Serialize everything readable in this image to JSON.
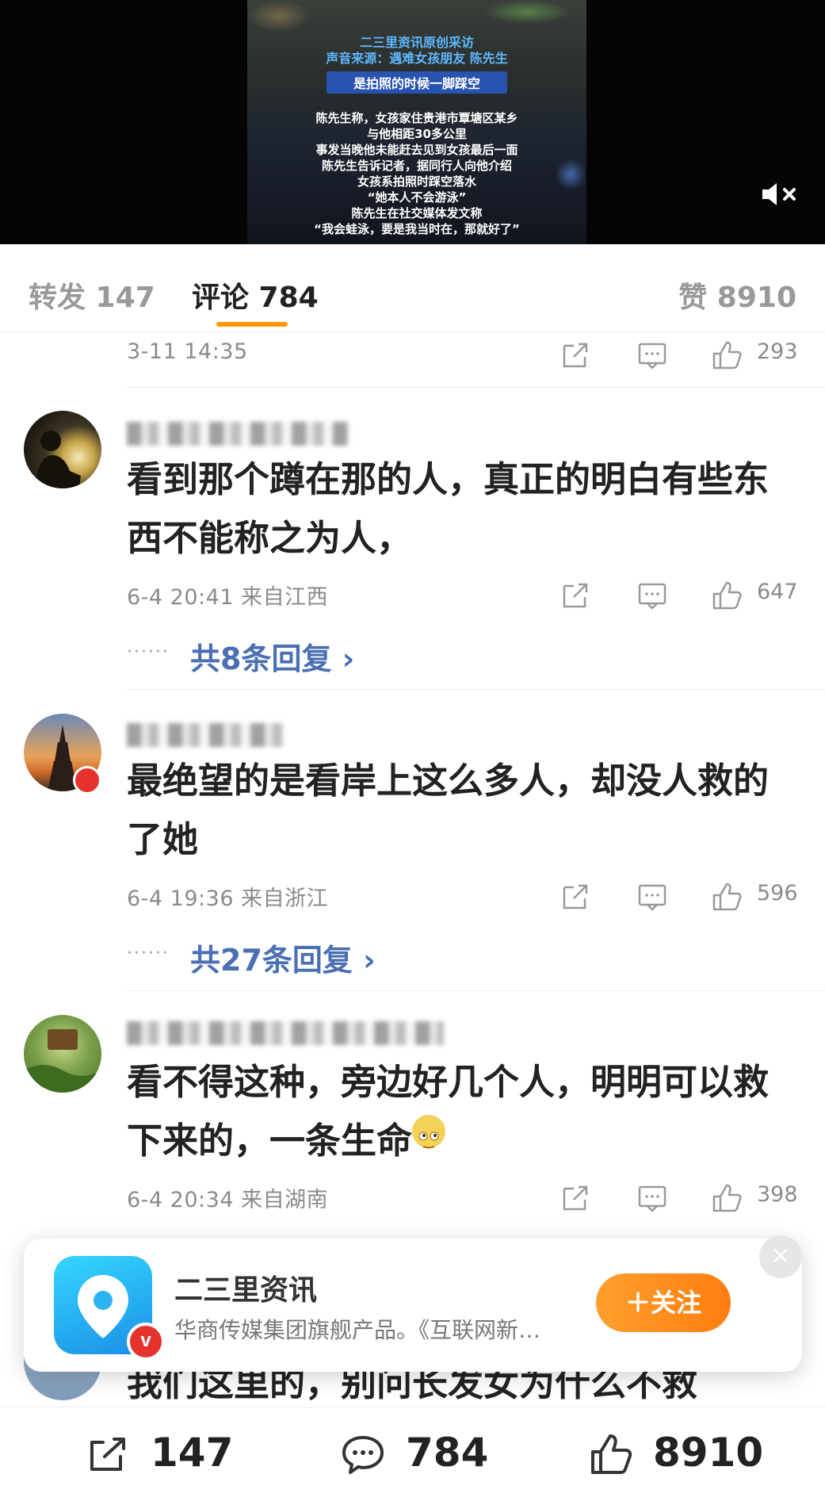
{
  "video": {
    "line1": "二三里资讯原创采访",
    "line2": "声音来源：遇难女孩朋友 陈先生",
    "highlight": "是拍照的时候一脚踩空",
    "lines": [
      "陈先生称，女孩家住贵港市覃塘区某乡",
      "与他相距30多公里",
      "事发当晚他未能赶去见到女孩最后一面",
      "陈先生告诉记者，据同行人向他介绍",
      "女孩系拍照时踩空落水",
      "“她本人不会游泳”",
      "陈先生在社交媒体发文称",
      "“我会蛙泳，要是我当时在，那就好了”"
    ]
  },
  "tabs": {
    "repost": "转发 147",
    "comment": "评论 784",
    "like": "赞 8910"
  },
  "top_meta": {
    "time": "3-11 14:35",
    "likes": "293"
  },
  "comments": [
    {
      "text": "看到那个蹲在那的人，真正的明白有些东西不能称之为人，",
      "meta": "6-4 20:41  来自江西",
      "likes": "647",
      "replies": "共8条回复 ›"
    },
    {
      "text": "最绝望的是看岸上这么多人，却没人救的了她",
      "meta": "6-4 19:36  来自浙江",
      "likes": "596",
      "replies": "共27条回复 ›"
    },
    {
      "text": "看不得这种，旁边好几个人，明明可以救下来的，一条生命",
      "meta": "6-4 20:34  来自湖南",
      "likes": "398"
    },
    {
      "text": "我们这里的，别问长发女为什么不救"
    }
  ],
  "card": {
    "name": "二三里资讯",
    "desc": "华商传媒集团旗舰产品。《互联网新…",
    "badge": "v",
    "follow": "＋关注",
    "close": "×"
  },
  "bottom": {
    "repost": "147",
    "comment": "784",
    "like": "8910"
  },
  "colors": {
    "accent": "#ff9800",
    "link": "#4a6fb3",
    "follow": "#ff8a1a"
  }
}
